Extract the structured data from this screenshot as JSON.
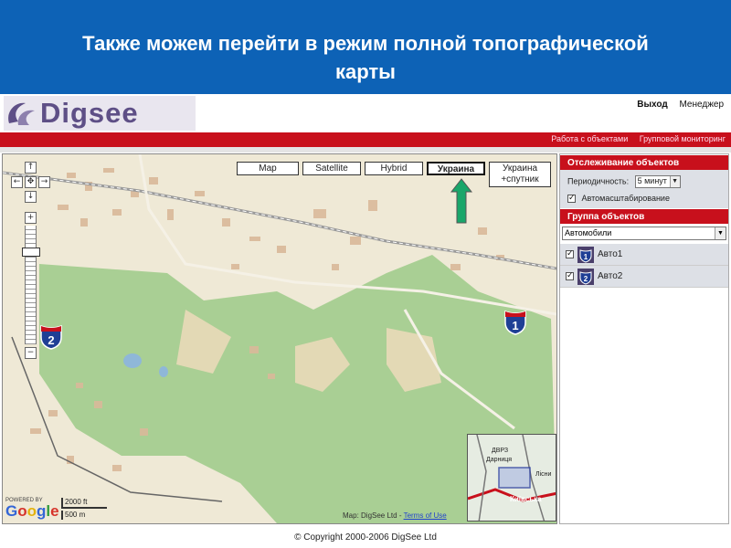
{
  "slide": {
    "title": "Также можем перейти в режим полной топографической карты"
  },
  "app": {
    "logo_text": "Digsee",
    "top_links": {
      "logout": "Выход",
      "manager": "Менеджер"
    },
    "nav_tabs": [
      "Работа с объектами",
      "Групповой мониторинг"
    ],
    "map_types": [
      {
        "label": "Map",
        "active": false
      },
      {
        "label": "Satellite",
        "active": false
      },
      {
        "label": "Hybrid",
        "active": false
      },
      {
        "label": "Украина",
        "active": true
      }
    ],
    "map_type_ukr_sat": {
      "line1": "Украина",
      "line2": "+спутник"
    },
    "nav_controls": {
      "up": "↑",
      "left": "←",
      "center": "✥",
      "right": "→",
      "down": "↓",
      "zoom_in": "+",
      "zoom_out": "−"
    },
    "shields": [
      "1",
      "2"
    ],
    "minimap_labels": [
      "ДВРЗ",
      "Дарниця",
      "Лісни",
      "Київська"
    ],
    "google": {
      "powered_by": "POWERED BY",
      "logo": "Google"
    },
    "scale": {
      "top": "2000 ft",
      "bottom": "500 m"
    },
    "attribution": {
      "text": "Map: DigSee Ltd - ",
      "link": "Terms of Use"
    },
    "panel": {
      "tracking_header": "Отслеживание объектов",
      "period_label": "Периодичность:",
      "period_value": "5 минут",
      "autoscale_label": "Автомасштабирование",
      "group_header": "Группа объектов",
      "group_value": "Автомобили",
      "objects": [
        {
          "label": "Авто1",
          "icon_num": "1"
        },
        {
          "label": "Авто2",
          "icon_num": "2"
        }
      ]
    },
    "footer": "© Copyright 2000-2006 DigSee Ltd",
    "colors": {
      "header_blue": "#0d62b6",
      "nav_red": "#c8101c",
      "map_green": "#a9cf94",
      "map_land": "#efe9d6",
      "hint_arrow": "#19a66a"
    }
  }
}
